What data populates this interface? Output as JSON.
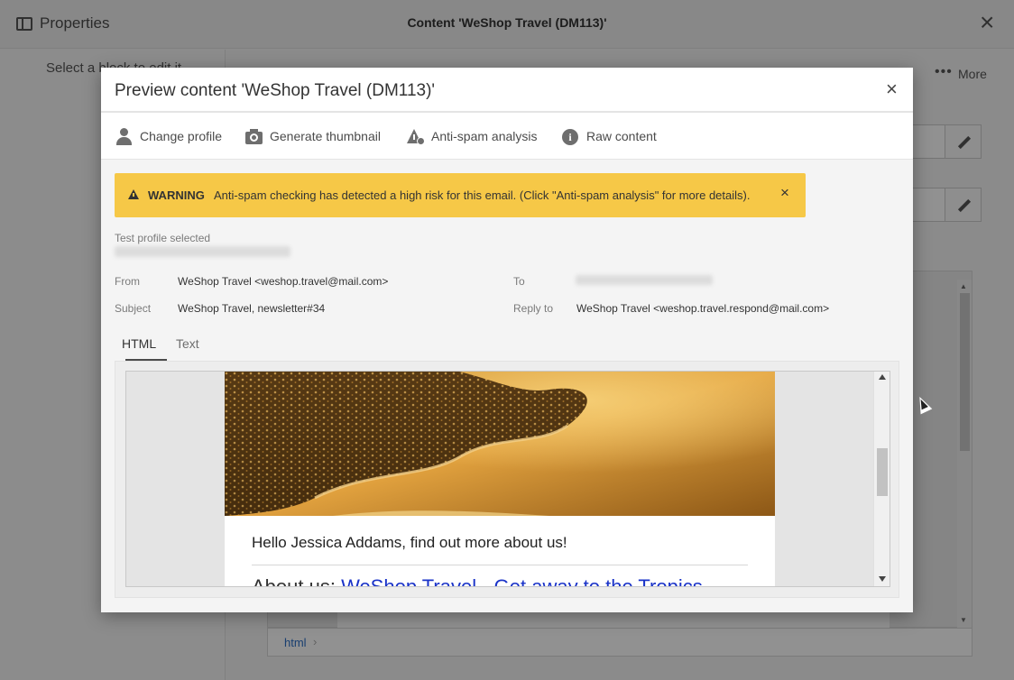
{
  "background": {
    "panel_title": "Properties",
    "window_title": "Content 'WeShop Travel (DM113)'",
    "left_hint": "Select a block to edit it",
    "more_label": "More",
    "path_item": "html"
  },
  "modal": {
    "title": "Preview content 'WeShop Travel (DM113)'",
    "close_glyph": "×",
    "toolbar": {
      "change_profile": "Change profile",
      "generate_thumbnail": "Generate thumbnail",
      "anti_spam": "Anti-spam analysis",
      "raw_content": "Raw content"
    },
    "warning": {
      "label": "WARNING",
      "text": "Anti-spam checking has detected a high risk for this email. (Click \"Anti-spam analysis\" for more details).",
      "close_glyph": "×",
      "color": "#f6c847"
    },
    "profile": {
      "label": "Test profile selected"
    },
    "meta": {
      "from_label": "From",
      "from_value": "WeShop Travel <weshop.travel@mail.com>",
      "subject_label": "Subject",
      "subject_value": "WeShop Travel, newsletter#34",
      "to_label": "To",
      "reply_label": "Reply to",
      "reply_value": "WeShop Travel <weshop.travel.respond@mail.com>"
    },
    "tabs": {
      "html": "HTML",
      "text": "Text"
    },
    "email": {
      "greeting": "Hello Jessica Addams, find out more about us!",
      "about_prefix": "About us: ",
      "about_link": "WeShop Travel - Get away to the Tropics",
      "link_color": "#1a33c8"
    }
  }
}
